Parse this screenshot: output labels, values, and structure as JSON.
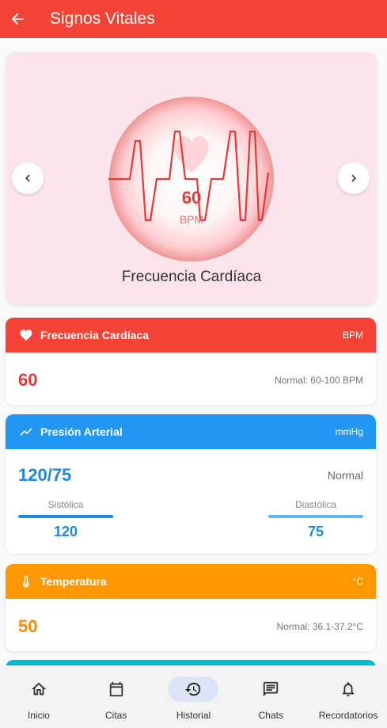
{
  "appbar": {
    "title": "Signos Vitales",
    "back_icon": "arrow-back-icon",
    "color": "#f44336"
  },
  "hero": {
    "value": "60",
    "unit": "BPM",
    "label": "Frecuencia Cardíaca",
    "background": "#fce4ec"
  },
  "cards": {
    "heart": {
      "title": "Frecuencia Cardíaca",
      "unit": "BPM",
      "value": "60",
      "normal": "Normal: 60-100 BPM",
      "color": "#f44336",
      "icon": "heart-icon"
    },
    "pressure": {
      "title": "Presión Arterial",
      "unit": "mmHg",
      "value": "120/75",
      "status": "Normal",
      "systolic_label": "Sistólica",
      "systolic_value": "120",
      "diastolic_label": "Diastólica",
      "diastolic_value": "75",
      "color": "#2196f3",
      "icon": "trending-up-icon"
    },
    "temperature": {
      "title": "Temperatura",
      "unit": "°C",
      "value": "50",
      "normal": "Normal: 36.1-37.2°C",
      "color": "#ff9800",
      "icon": "thermometer-icon"
    }
  },
  "bottom_nav": {
    "items": [
      {
        "label": "Inicio",
        "icon": "home-icon",
        "active": false
      },
      {
        "label": "Citas",
        "icon": "calendar-icon",
        "active": false
      },
      {
        "label": "Historial",
        "icon": "history-icon",
        "active": true
      },
      {
        "label": "Chats",
        "icon": "chat-icon",
        "active": false
      },
      {
        "label": "Recordatorios",
        "icon": "bell-icon",
        "active": false
      }
    ]
  }
}
